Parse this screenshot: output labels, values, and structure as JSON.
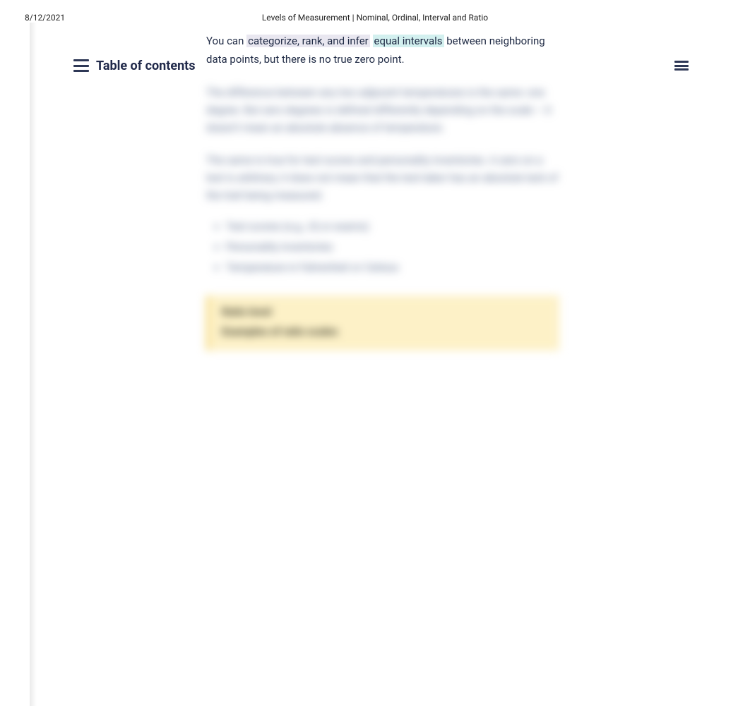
{
  "print": {
    "date": "8/12/2021",
    "title": "Levels of Measurement | Nominal, Ordinal, Interval and Ratio"
  },
  "toc": {
    "label": "Table of contents"
  },
  "content": {
    "intro_prefix": "You can ",
    "intro_hlA": "categorize, rank, and infer",
    "intro_mid": " ",
    "intro_hlB": "equal intervals",
    "intro_suffix": " between neighboring data points, but there is no true zero point.",
    "blur_p1": "The difference between any two adjacent temperatures is the same: one degree. But zero degrees is defined differently depending on the scale – it doesn't mean an absolute absence of temperature.",
    "blur_p2": "The same is true for test scores and personality inventories. A zero on a test is arbitrary; it does not mean that the test-taker has an absolute lack of the trait being measured.",
    "list_items": [
      "Test scores (e.g., IQ or exams)",
      "Personality inventories",
      "Temperature in Fahrenheit or Celsius"
    ],
    "callout_title": "Ratio level",
    "callout_sub": "Examples of ratio scales"
  }
}
